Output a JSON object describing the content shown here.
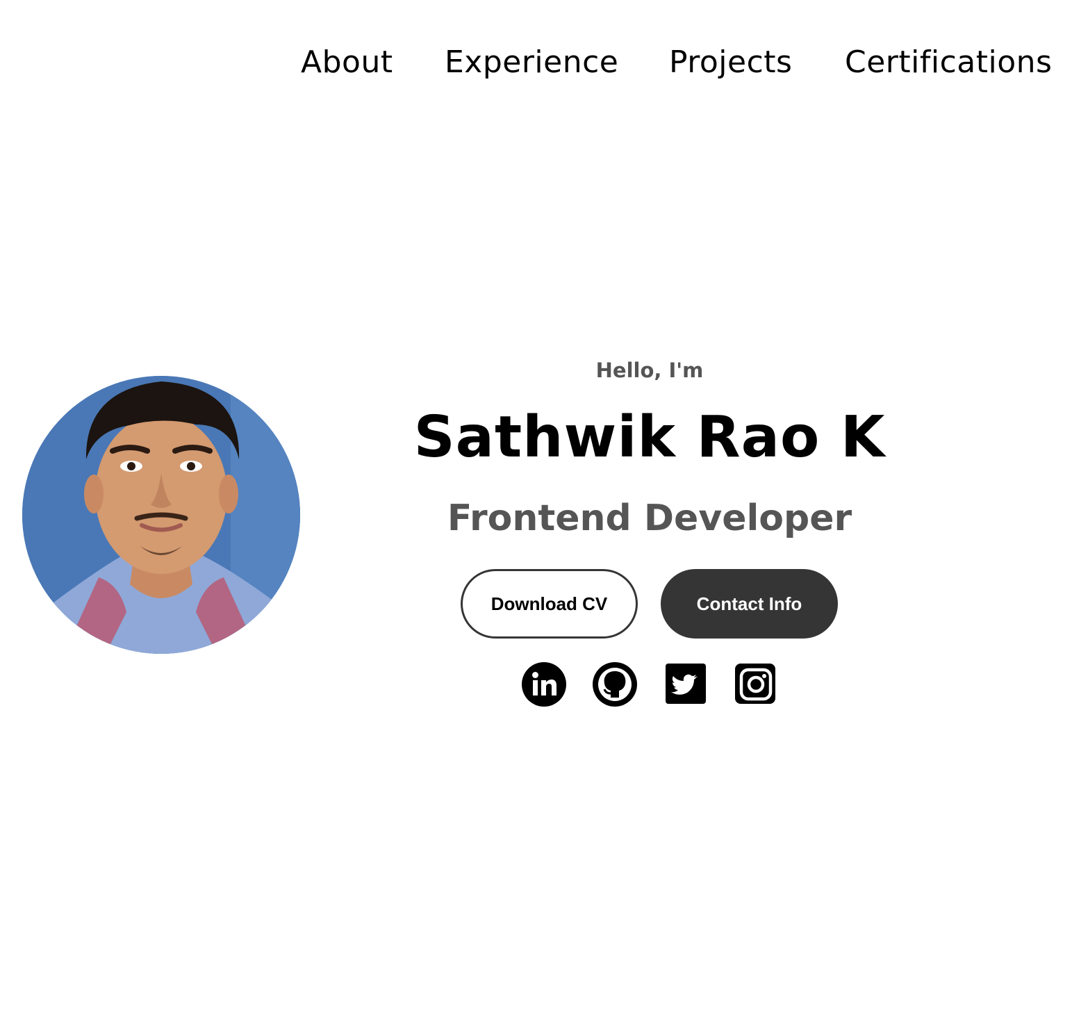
{
  "nav": {
    "items": [
      {
        "label": "About"
      },
      {
        "label": "Experience"
      },
      {
        "label": "Projects"
      },
      {
        "label": "Certifications"
      }
    ]
  },
  "hero": {
    "greeting": "Hello, I'm",
    "name": "Sathwik Rao K",
    "role": "Frontend Developer",
    "buttons": {
      "download_cv": "Download CV",
      "contact_info": "Contact Info"
    },
    "social_icons": [
      "linkedin-icon",
      "github-icon",
      "twitter-icon",
      "instagram-icon"
    ]
  },
  "colors": {
    "text_primary": "#000000",
    "text_secondary": "#555555",
    "button_dark": "#353535",
    "photo_backdrop": "#4c7ab8"
  }
}
